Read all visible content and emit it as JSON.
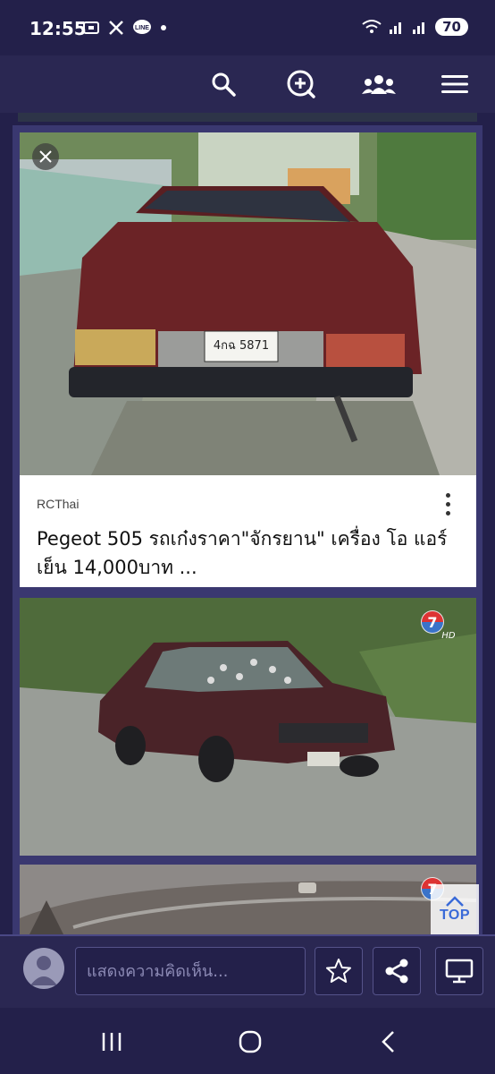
{
  "status_bar": {
    "time": "12:55",
    "battery": "70",
    "icons_left": [
      "screenshot-icon",
      "x-icon",
      "line-icon",
      "dot-icon"
    ],
    "icons_right": [
      "wifi-icon",
      "signal-icon",
      "signal-icon",
      "battery-icon"
    ]
  },
  "app_bar": {
    "actions": [
      "search-icon",
      "zoom-plus-icon",
      "group-icon",
      "menu-icon"
    ]
  },
  "feed": {
    "cards": [
      {
        "source": "RCThai",
        "title": "Pegeot 505 รถเก๋งราคา\"จักรยาน\" เครื่อง โอ แอร์เย็น 14,000บาท ...",
        "image": "maroon Peugeot 505 sedan rear view parked on a street",
        "plate_text": "4กฉ 5871"
      },
      {
        "image": "dark red Peugeot 505 sedan with bullet holes in windshield",
        "logo": "ch7-hd-logo",
        "logo_text": "HD"
      },
      {
        "image": "car roof close-up",
        "logo": "ch7-logo"
      }
    ]
  },
  "top_button": {
    "label": "TOP"
  },
  "bottom_bar": {
    "comment_placeholder": "แสดงความคิดเห็น...",
    "actions": [
      "star-icon",
      "share-icon",
      "monitor-icon"
    ]
  },
  "nav_bar": {
    "buttons": [
      "recents-icon",
      "home-icon",
      "back-icon"
    ]
  },
  "colors": {
    "background": "#23204a",
    "bar": "#2a2752",
    "accent": "#3a6ad8"
  }
}
